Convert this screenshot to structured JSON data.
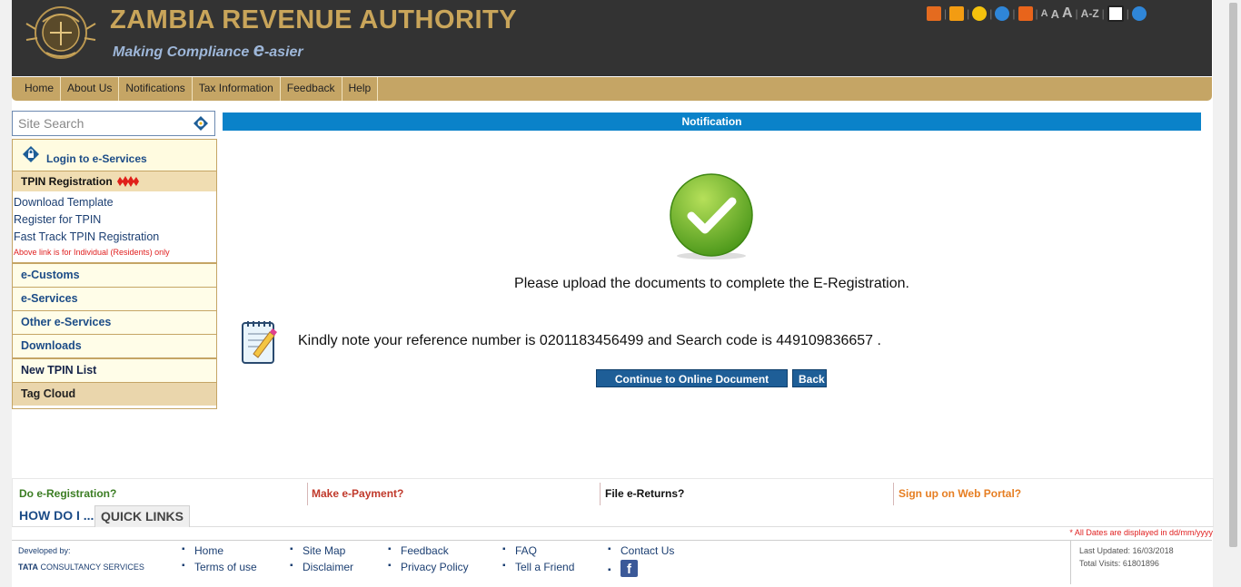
{
  "header": {
    "title": "ZAMBIA REVENUE AUTHORITY",
    "tagline_pre": "Making Compliance ",
    "tagline_e": "e",
    "tagline_post": "-asier",
    "font_sizes": [
      "A",
      "A",
      "A"
    ],
    "az": "A-Z"
  },
  "nav": {
    "items": [
      "Home",
      "About Us",
      "Notifications",
      "Tax Information",
      "Feedback",
      "Help"
    ]
  },
  "search": {
    "placeholder": "Site Search"
  },
  "sidebar": {
    "login": "Login to  e-Services",
    "tpin_head": "TPIN Registration",
    "links": [
      "Download Template",
      "Register for TPIN",
      "Fast Track TPIN Registration"
    ],
    "note": "Above link is for Individual (Residents) only",
    "sections": [
      "e-Customs",
      "e-Services",
      "Other e-Services",
      "Downloads"
    ],
    "new_tpin": "New TPIN List",
    "tag_cloud": "Tag Cloud"
  },
  "main": {
    "bar_title": "Notification",
    "message": "Please upload the documents to complete the E-Registration.",
    "reference_message": "Kindly note your reference number is 0201183456499 and Search code is 449109836657 .",
    "continue_label": "Continue to Online Document Upload",
    "back_label": "Back"
  },
  "howdo": {
    "items": [
      {
        "label": "Do e-Registration?",
        "color": "#3b7d23"
      },
      {
        "label": "Make e-Payment?",
        "color": "#c0392b"
      },
      {
        "label": "File e-Returns?",
        "color": "#111111"
      },
      {
        "label": "Sign up on Web Portal?",
        "color": "#e67e22"
      }
    ],
    "tab1": "HOW DO I ...",
    "tab2": "QUICK LINKS"
  },
  "dates_note": "* All Dates are displayed in dd/mm/yyyy",
  "footer": {
    "developed_by": "Developed by:",
    "tcs_bold": "TATA",
    "tcs_rest": " CONSULTANCY SERVICES",
    "links_row1": [
      "Home",
      "Site Map",
      "Feedback",
      "FAQ",
      "Contact Us"
    ],
    "links_row2": [
      "Terms of use",
      "Disclaimer",
      "Privacy Policy",
      "Tell a Friend"
    ],
    "fb": "f",
    "last_updated": "Last Updated: 16/03/2018",
    "total_visits": "Total Visits: 61801896"
  }
}
